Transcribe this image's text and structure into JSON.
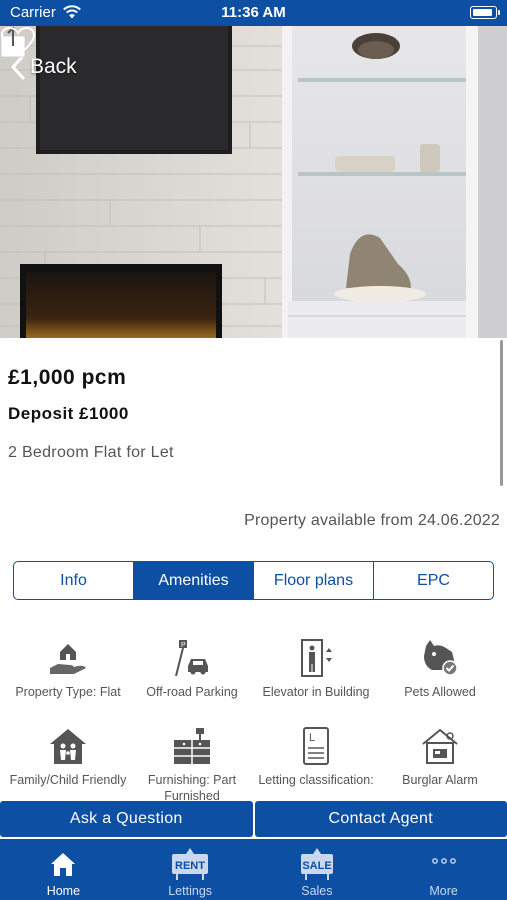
{
  "status_bar": {
    "carrier": "Carrier",
    "time": "11:36 AM",
    "battery_level": 0.9
  },
  "header": {
    "back_label": "Back"
  },
  "listing": {
    "price": "£1,000 pcm",
    "deposit": "Deposit £1000",
    "type": "2 Bedroom Flat for Let",
    "availability": "Property available from 24.06.2022"
  },
  "tabs": [
    {
      "label": "Info",
      "active": false
    },
    {
      "label": "Amenities",
      "active": true
    },
    {
      "label": "Floor plans",
      "active": false
    },
    {
      "label": "EPC",
      "active": false
    }
  ],
  "amenities": [
    {
      "label": "Property Type: Flat",
      "icon": "house-hand-icon"
    },
    {
      "label": "Off-road Parking",
      "icon": "parking-icon"
    },
    {
      "label": "Elevator in Building",
      "icon": "elevator-icon"
    },
    {
      "label": "Pets Allowed",
      "icon": "pets-icon"
    },
    {
      "label": "Family/Child Friendly",
      "icon": "family-icon"
    },
    {
      "label": "Furnishing: Part Furnished",
      "icon": "furniture-icon"
    },
    {
      "label": "Letting classification:",
      "icon": "letting-icon"
    },
    {
      "label": "Burglar Alarm",
      "icon": "alarm-icon"
    }
  ],
  "actions": {
    "ask_question": "Ask a Question",
    "contact_agent": "Contact Agent"
  },
  "tab_bar": [
    {
      "label": "Home",
      "icon": "home-icon",
      "active": true
    },
    {
      "label": "Lettings",
      "icon": "rent-sign-icon",
      "active": false,
      "icon_text": "RENT"
    },
    {
      "label": "Sales",
      "icon": "sale-sign-icon",
      "active": false,
      "icon_text": "SALE"
    },
    {
      "label": "More",
      "icon": "more-icon",
      "active": false
    }
  ],
  "colors": {
    "brand_blue": "#0d4fa3",
    "text_dark": "#111111",
    "text_muted": "#555555"
  }
}
